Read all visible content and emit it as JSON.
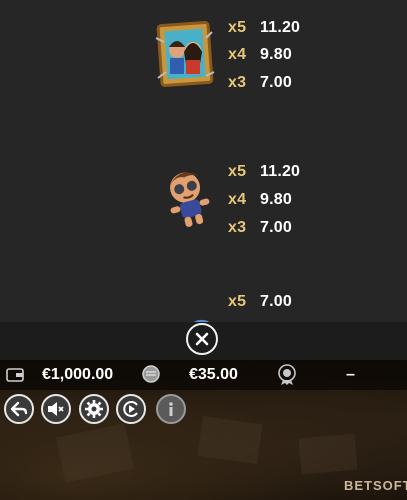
{
  "paytable": {
    "symbols": [
      {
        "name": "couple-portrait",
        "pays": [
          {
            "mult": "x5",
            "amount": "11.20"
          },
          {
            "mult": "x4",
            "amount": "9.80"
          },
          {
            "mult": "x3",
            "amount": "7.00"
          }
        ]
      },
      {
        "name": "voodoo-doll",
        "pays": [
          {
            "mult": "x5",
            "amount": "11.20"
          },
          {
            "mult": "x4",
            "amount": "9.80"
          },
          {
            "mult": "x3",
            "amount": "7.00"
          }
        ]
      },
      {
        "name": "partial-symbol",
        "pays": [
          {
            "mult": "x5",
            "amount": "7.00"
          }
        ]
      }
    ]
  },
  "info_bar": {
    "balance": "€1,000.00",
    "bet": "€35.00",
    "win": "–"
  },
  "controls": [
    "back-icon",
    "mute-icon",
    "settings-icon",
    "autoplay-icon",
    "info-icon"
  ],
  "brand": {
    "logo": "BETSOFT"
  },
  "colors": {
    "multiplier": "#e6c77a",
    "background": "#262626",
    "bar": "#000000"
  }
}
